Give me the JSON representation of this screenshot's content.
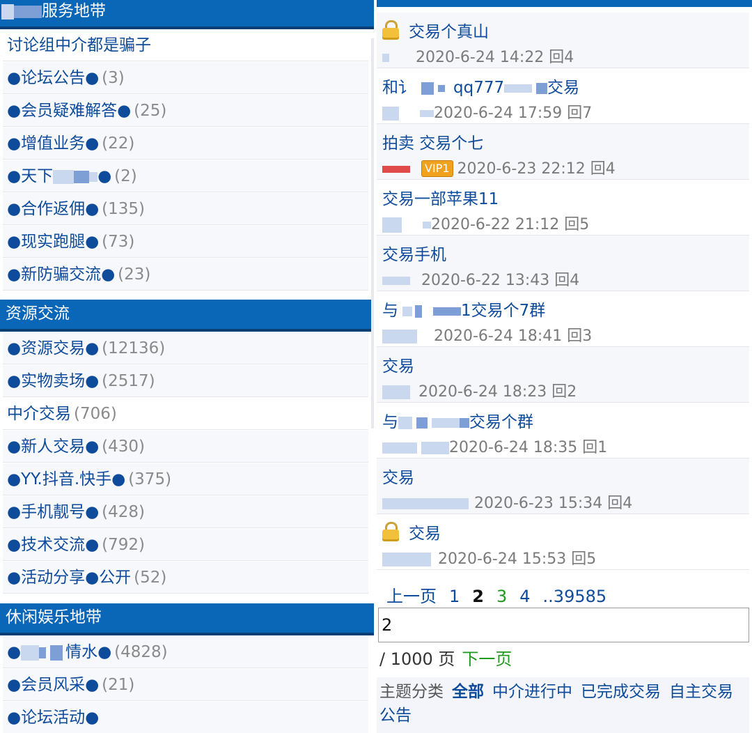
{
  "left": {
    "sections": [
      {
        "title": "服务地带",
        "items": [
          {
            "label": "讨论组中介都是骗子",
            "count": ""
          },
          {
            "label": "●论坛公告●",
            "count": "(3)"
          },
          {
            "label": "●会员疑难解答●",
            "count": "(25)"
          },
          {
            "label": "●增值业务●",
            "count": "(22)"
          },
          {
            "label": "●天下",
            "count": "(2)",
            "suffix": "●"
          },
          {
            "label": "●合作返佣●",
            "count": "(135)"
          },
          {
            "label": "●现实跑腿●",
            "count": "(73)"
          },
          {
            "label": "●新防骗交流●",
            "count": "(23)"
          }
        ]
      },
      {
        "title": "资源交流",
        "items": [
          {
            "label": "●资源交易●",
            "count": "(12136)"
          },
          {
            "label": "●实物卖场●",
            "count": "(2517)"
          },
          {
            "label": "中介交易",
            "count": "(706)"
          },
          {
            "label": "●新人交易●",
            "count": "(430)"
          },
          {
            "label": "●YY.抖音.快手●",
            "count": "(375)"
          },
          {
            "label": "●手机靓号●",
            "count": "(428)"
          },
          {
            "label": "●技术交流●",
            "count": "(792)"
          },
          {
            "label": "●活动分享●公开",
            "count": "(52)"
          }
        ]
      },
      {
        "title": "休闲娱乐地带",
        "items": [
          {
            "label": "情水●",
            "count": "(4828)"
          },
          {
            "label": "●会员风采●",
            "count": "(21)"
          },
          {
            "label": "●论坛活动●",
            "count": ""
          }
        ]
      }
    ]
  },
  "right": {
    "threads": [
      {
        "title": "交易个真山",
        "meta": "2020-6-24 14:22 回4",
        "locked": true
      },
      {
        "title": "和讠",
        "title2": "qq777",
        "title3": "交易",
        "meta": "2020-6-24 17:59 回7"
      },
      {
        "title": "拍卖 交易个七",
        "meta": "2020-6-23 22:12 回4",
        "vip": "VIP1"
      },
      {
        "title": "交易一部苹果11",
        "meta": "2020-6-22 21:12 回5"
      },
      {
        "title": "交易手机",
        "meta": "2020-6-22 13:43 回4"
      },
      {
        "title": "与",
        "title2": "1交易个7群",
        "meta": "2020-6-24 18:41 回3"
      },
      {
        "title": "交易",
        "meta": "2020-6-24 18:23 回2"
      },
      {
        "title": "与",
        "title2": "交易个群",
        "meta": "2020-6-24 18:35 回1"
      },
      {
        "title": "交易",
        "meta": "2020-6-23 15:34 回4"
      },
      {
        "title": "交易",
        "meta": "2020-6-24 15:53 回5",
        "locked": true
      }
    ],
    "pager": {
      "prev": "上一页",
      "pages": [
        "1",
        "2",
        "3",
        "4"
      ],
      "last": "..39585"
    },
    "page_input": "2",
    "page_total": "/ 1000 页",
    "next": "下一页",
    "categories": {
      "label": "主题分类",
      "items": [
        "全部",
        "中介进行中",
        "已完成交易",
        "自主交易",
        "公告"
      ]
    }
  },
  "colors": {
    "header_blue": "#0a67b7",
    "link_blue": "#0e4c9b",
    "count_gray": "#8a8a8a",
    "pager_green": "#1e9a1e",
    "vip_orange": "#f0a21e"
  }
}
